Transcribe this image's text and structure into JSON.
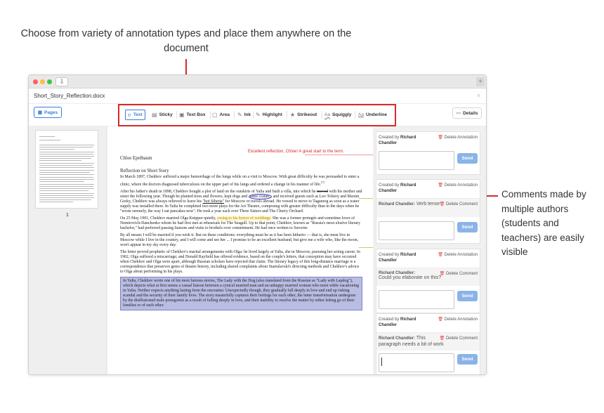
{
  "callouts": {
    "top": "Choose from variety of annotation types and place them anywhere on the document",
    "right": "Comments made by multiple authors (students and teachers) are easily visible"
  },
  "window": {
    "filename": "Short_Story_Reflection.docx",
    "close_icon": "close-icon",
    "download_icon": "download-icon"
  },
  "toolbar": {
    "pages_label": "Pages",
    "details_label": "Details",
    "tools": [
      {
        "label": "Text",
        "icon": "text-cursor-icon"
      },
      {
        "label": "Sticky",
        "icon": "sticky-note-icon"
      },
      {
        "label": "Text Box",
        "icon": "text-box-icon"
      },
      {
        "label": "Area",
        "icon": "area-icon"
      },
      {
        "label": "Ink",
        "icon": "pen-icon"
      },
      {
        "label": "Highlight",
        "icon": "highlighter-icon"
      },
      {
        "label": "Strikeout",
        "icon": "strikeout-icon"
      },
      {
        "label": "Squiggly",
        "icon": "squiggly-icon"
      },
      {
        "label": "Underline",
        "icon": "underline-icon"
      }
    ],
    "active_tool": "Text"
  },
  "thumbnails": {
    "page_number": "1"
  },
  "document": {
    "inline_comment": "Excellent reflection, Chloe! A great start to the term.",
    "author": "Chloe Epelbaum",
    "title": "Reflection on Short Story",
    "p1": "In March 1897, Chekhov suffered a major hemorrhage of the lungs while on a visit to Moscow. With great difficulty he was persuaded to enter a clinic, where the doctors diagnosed tuberculosis on the upper part of his lungs and ordered a change in his manner of life.",
    "p1_ref": "[7]",
    "p2a": "After his father's death in 1898, Chekhov bought a plot of land on the outskirts of Yalta and built a villa, into which he",
    "p2_strike": "moved",
    "p2b": "with his mother and sister the following year. Though he planted trees and flowers, kept dogs and",
    "p2_circle": "tame cranes,",
    "p2c": "and received guests such as Leo Tolstoy and Maxim Gorky, Chekhov was always relieved to leave his",
    "p2_underline": "\"hot Siberia\"",
    "p2d": "for Moscow or travels abroad. He vowed to move to Taganrog as soon as a water supply was installed there. In Yalta he completed two more plays for the Art Theatre, composing with greater difficulty than in the days when he \"wrote serenely, the way I eat pancakes now\". He took a year each over Three Sisters and The Cherry Orchard.",
    "p3a": "On 25 May 1901, Chekhov married Olga Knipper quietly,",
    "p3_highlight": "owing to his horror of weddings.",
    "p3b": "She was a former protegée and sometime lover of Nemirovich-Danchenko whom he had first met at rehearsals for The Seagull. Up to that point, Chekhov, known as \"Russia's most elusive literary bachelor,\" had preferred passing liaisons and visits to brothels over commitment. He had once written to Suvorin:",
    "p4": "By all means I will be married if you wish it. But on these conditions: everything must be as it has been hitherto — that is, she must live in Moscow while I live in the country, and I will come and see her ... I promise to be an excellent husband, but give me a wife who, like the moon, won't appear in my sky every day.",
    "p5": "The letter proved prophetic of Chekhov's marital arrangements with Olga: he lived largely at Yalta, she in Moscow, pursuing her acting career. In 1902, Olga suffered a miscarriage; and Donald Rayfield has offered evidence, based on the couple's letters, that conception may have occurred when Chekhov and Olga were apart, although Russian scholars have rejected that claim. The literary legacy of this long-distance marriage is a correspondence that preserves gems of theatre history, including shared complaints about Stanislavski's directing methods and Chekhov's advice to Olga about performing in his plays.",
    "p6": "In Yalta, Chekhov wrote one of his most famous stories, The Lady with the Dog (also translated from the Russian as \"Lady with Lapdog\"), which depicts what at first seems a casual liaison between a cynical married man and an unhappy married woman who meet while vacationing in Yalta. Neither expects anything lasting from the encounter. Unexpectedly though, they gradually fall deeply in love and end up risking scandal and the security of their family lives. The story masterfully captures their feelings for each other, the inner transformation undergone by the disillusioned male protagonist as a result of falling deeply in love, and their inability to resolve the matter by either letting go of their families or of each other."
  },
  "annotations": {
    "created_by": "Created by",
    "author_name": "Richard Chandler",
    "delete_annotation": "Delete Annotation",
    "delete_comment": "Delete Comment",
    "send_label": "Send",
    "reply_author": "Richard Chandler:",
    "card2_reply": "Verb tense",
    "card3_reply": "Could you elaborate on this?",
    "card4_reply_a": "This",
    "card4_reply_b": "paragraph needs a bit of work",
    "colors": {
      "accent": "#3c7cd6",
      "callout_red": "#d42a2a",
      "delete_red": "#e04848",
      "area_fill": "#b9bde3"
    }
  }
}
